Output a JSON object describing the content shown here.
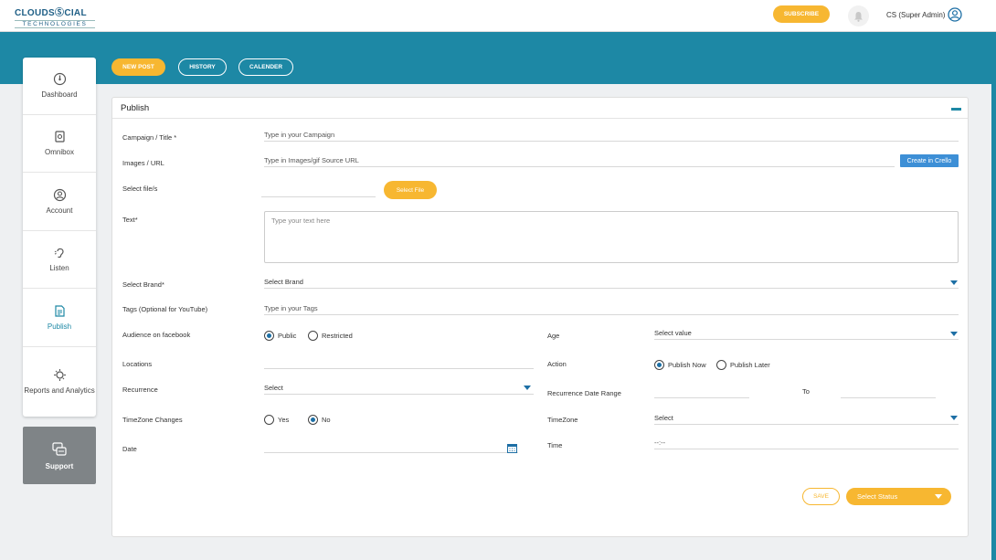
{
  "header": {
    "logo_main": "CLOUDSⓈCIAL",
    "logo_sub": "TECHNOLOGIES",
    "subscribe": "SUBSCRIBE",
    "user": "CS (Super Admin)"
  },
  "tabs": {
    "new_post": "NEW POST",
    "history": "HISTORY",
    "calender": "CALENDER"
  },
  "sidebar": {
    "items": [
      {
        "label": "Dashboard",
        "icon": "dashboard-icon"
      },
      {
        "label": "Omnibox",
        "icon": "omnibox-icon"
      },
      {
        "label": "Account",
        "icon": "account-icon"
      },
      {
        "label": "Listen",
        "icon": "listen-icon"
      },
      {
        "label": "Publish",
        "icon": "publish-icon"
      },
      {
        "label": "Reports and Analytics",
        "icon": "reports-icon"
      }
    ],
    "support": "Support"
  },
  "panel": {
    "title": "Publish",
    "campaign_label": "Campaign / Title *",
    "campaign_placeholder": "Type in your Campaign",
    "images_label": "Images / URL",
    "images_placeholder": "Type in Images/gif Source URL",
    "crello_button": "Create in Crello",
    "file_label": "Select file/s",
    "file_button": "Select File",
    "text_label": "Text*",
    "text_placeholder": "Type your text here",
    "brand_label": "Select Brand*",
    "brand_value": "Select Brand",
    "tags_label": "Tags (Optional for YouTube)",
    "tags_placeholder": "Type in your Tags",
    "audience_label": "Audience on facebook",
    "audience_public": "Public",
    "audience_restricted": "Restricted",
    "age_label": "Age",
    "age_value": "Select value",
    "locations_label": "Locations",
    "action_label": "Action",
    "action_now": "Publish Now",
    "action_later": "Publish Later",
    "recurrence_label": "Recurrence",
    "recurrence_value": "Select",
    "range_label": "Recurrence Date Range",
    "range_to": "To",
    "tzchange_label": "TimeZone Changes",
    "tz_yes": "Yes",
    "tz_no": "No",
    "timezone_label": "TimeZone",
    "timezone_value": "Select",
    "date_label": "Date",
    "time_label": "Time",
    "time_value": "--:--",
    "save": "SAVE",
    "status": "Select Status"
  }
}
